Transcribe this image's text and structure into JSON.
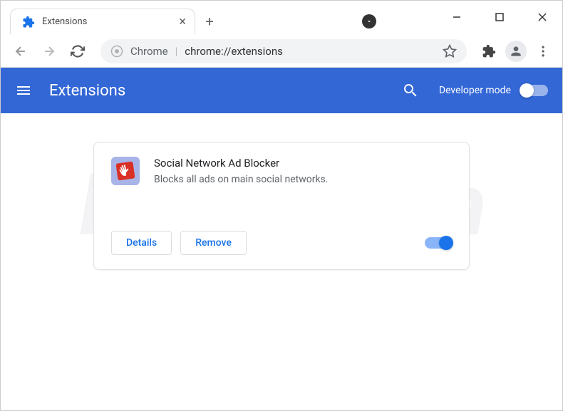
{
  "window": {
    "minimize": "—",
    "maximize": "☐",
    "close": "✕"
  },
  "tab": {
    "title": "Extensions",
    "close": "×",
    "new_tab": "+"
  },
  "omnibox": {
    "security_label": "Chrome",
    "separator": "|",
    "url": "chrome://extensions"
  },
  "app_header": {
    "title": "Extensions",
    "dev_mode_label": "Developer mode"
  },
  "extension": {
    "name": "Social Network Ad Blocker",
    "description": "Blocks all ads on main social networks.",
    "details_label": "Details",
    "remove_label": "Remove",
    "enabled": true
  },
  "watermark": {
    "text": "PCrisk.com"
  },
  "icons": {
    "favicon": "puzzle-icon",
    "back": "arrow-left",
    "forward": "arrow-right",
    "reload": "reload",
    "star": "star",
    "extensions": "puzzle",
    "profile": "person",
    "menu": "dots-vertical",
    "hamburger": "menu",
    "search": "search"
  }
}
